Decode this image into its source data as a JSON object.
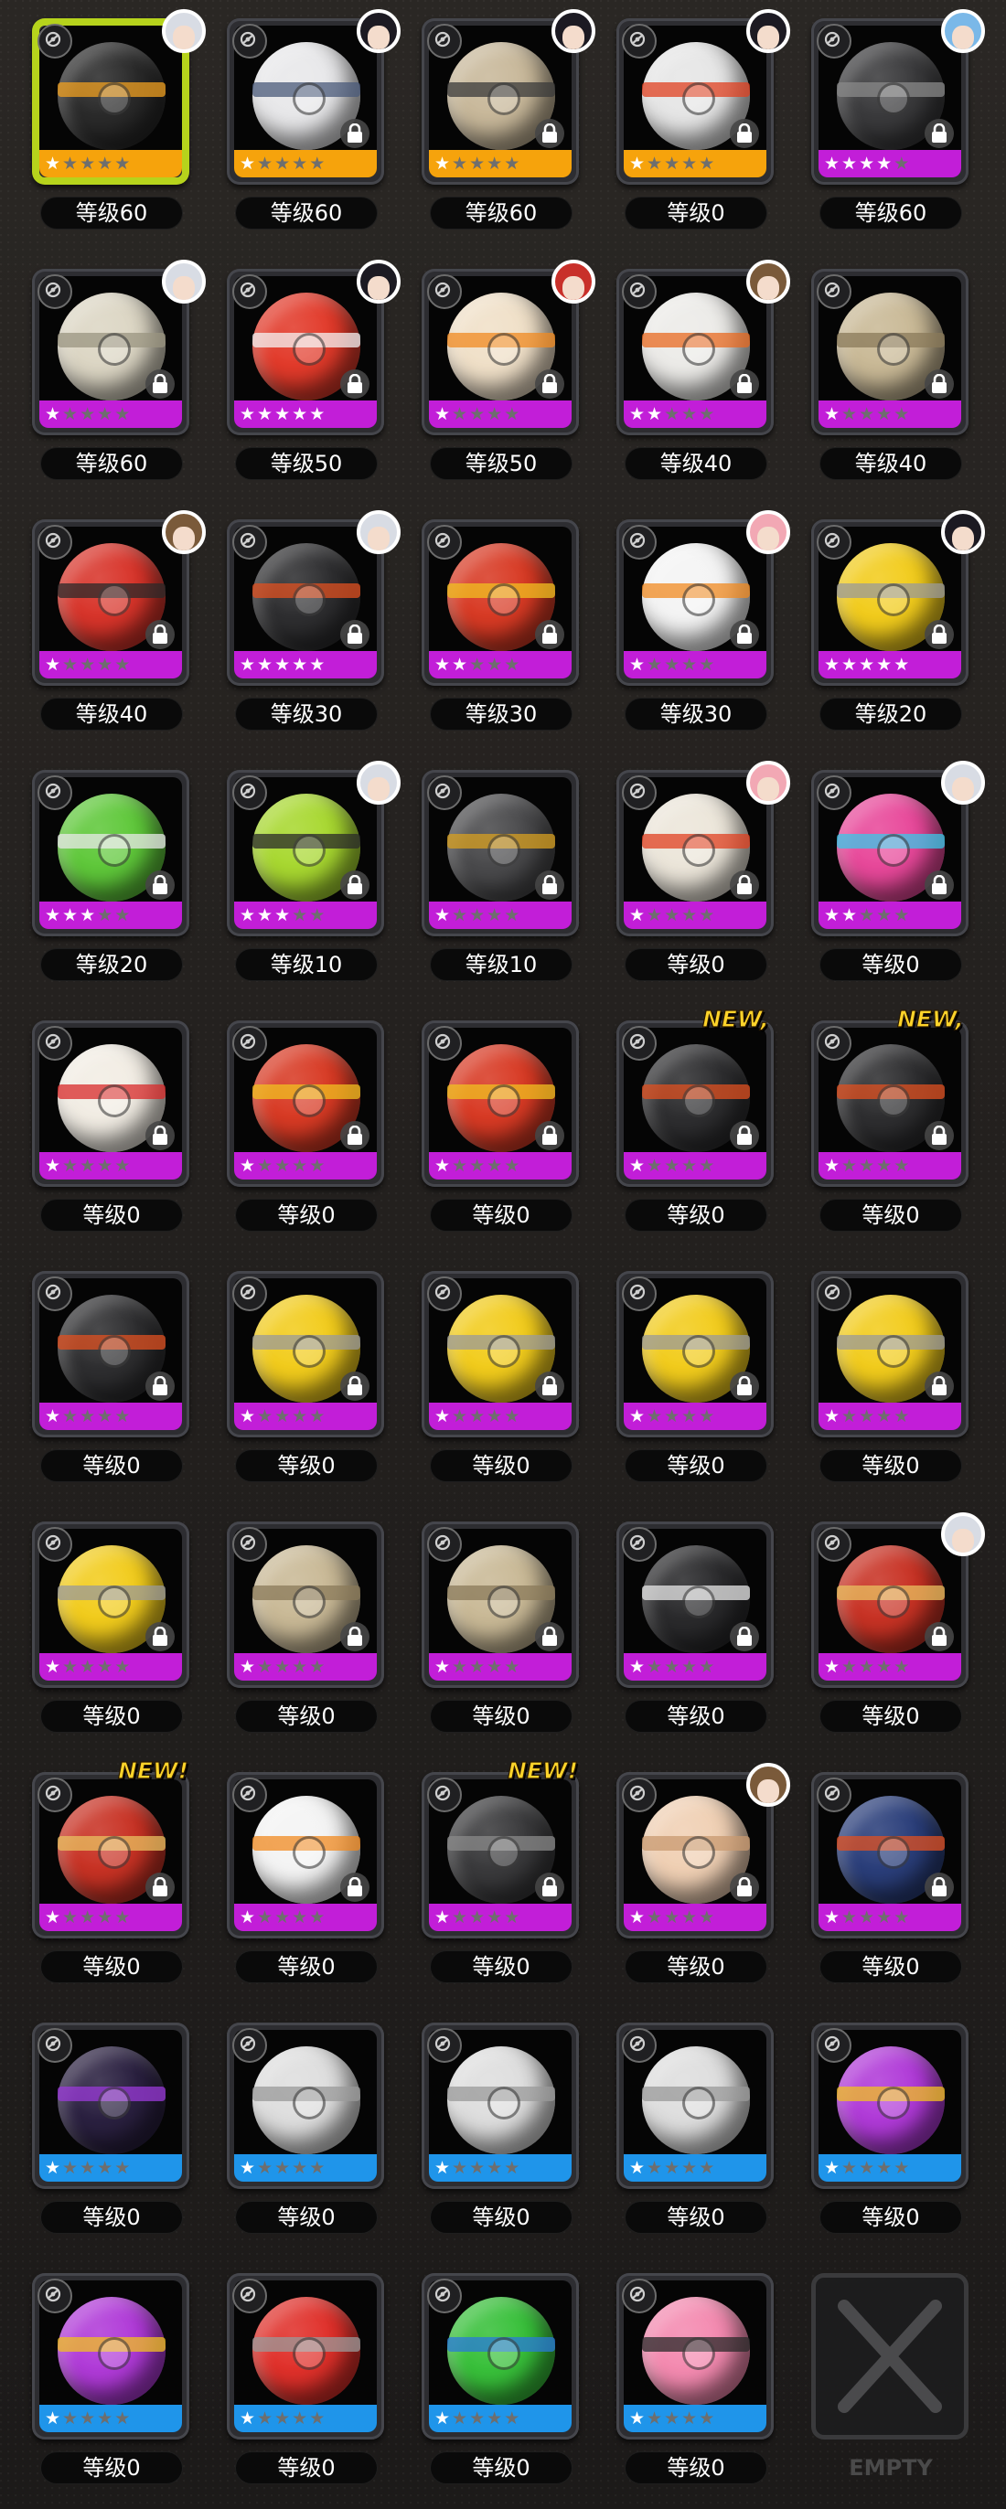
{
  "colors": {
    "selected_border": "#b6d31c",
    "rarity_orange": "#f6a30c",
    "rarity_purple": "#c21ed8",
    "rarity_blue": "#1f95ea",
    "new_badge": "#ffd42a"
  },
  "new_badge_labels": {
    "comma": "NEW,",
    "exclaim": "NEW!"
  },
  "empty_slot": {
    "label": "EMPTY",
    "icon": "x-mark-icon"
  },
  "items": [
    {
      "level": "等级60",
      "rarity": "orange",
      "stars": 1,
      "locked": false,
      "selected": true,
      "portrait": "silver",
      "ball": "#2a2a2a",
      "accent": "#f0a020",
      "new": ""
    },
    {
      "level": "等级60",
      "rarity": "orange",
      "stars": 1,
      "locked": true,
      "portrait": "dark",
      "ball": "#e8e8ea",
      "accent": "#4a5a7a",
      "new": ""
    },
    {
      "level": "等级60",
      "rarity": "orange",
      "stars": 1,
      "locked": true,
      "portrait": "dark",
      "ball": "#c8b89a",
      "accent": "#3a3a3a",
      "new": ""
    },
    {
      "level": "等级0",
      "rarity": "orange",
      "stars": 1,
      "locked": true,
      "portrait": "dark",
      "ball": "#e6e6e6",
      "accent": "#e04020",
      "new": ""
    },
    {
      "level": "等级60",
      "rarity": "purple",
      "stars": 4,
      "locked": true,
      "portrait": "blue",
      "ball": "#3a3a3c",
      "accent": "#8a8a8a",
      "new": ""
    },
    {
      "level": "等级60",
      "rarity": "purple",
      "stars": 1,
      "locked": true,
      "portrait": "silver",
      "ball": "#dcd6c4",
      "accent": "#9a9480",
      "new": ""
    },
    {
      "level": "等级50",
      "rarity": "purple",
      "stars": 5,
      "locked": true,
      "portrait": "dark",
      "ball": "#e23a2a",
      "accent": "#f4f4f4",
      "new": ""
    },
    {
      "level": "等级50",
      "rarity": "purple",
      "stars": 1,
      "locked": true,
      "portrait": "red",
      "ball": "#f0e0c8",
      "accent": "#f08a20",
      "new": ""
    },
    {
      "level": "等级40",
      "rarity": "purple",
      "stars": 2,
      "locked": true,
      "portrait": "brown",
      "ball": "#ecebe8",
      "accent": "#e86a20",
      "new": ""
    },
    {
      "level": "等级40",
      "rarity": "purple",
      "stars": 1,
      "locked": true,
      "portrait": "",
      "ball": "#c9b996",
      "accent": "#8a7a5a",
      "new": ""
    },
    {
      "level": "等级40",
      "rarity": "purple",
      "stars": 1,
      "locked": true,
      "portrait": "brown",
      "ball": "#d8342a",
      "accent": "#2a2a2a",
      "new": ""
    },
    {
      "level": "等级30",
      "rarity": "purple",
      "stars": 5,
      "locked": true,
      "portrait": "silver",
      "ball": "#2e2e30",
      "accent": "#e05020",
      "new": ""
    },
    {
      "level": "等级30",
      "rarity": "purple",
      "stars": 2,
      "locked": true,
      "portrait": "",
      "ball": "#d83a24",
      "accent": "#f0c020",
      "new": ""
    },
    {
      "level": "等级30",
      "rarity": "purple",
      "stars": 1,
      "locked": true,
      "portrait": "pink",
      "ball": "#f4f4f4",
      "accent": "#f08a20",
      "new": ""
    },
    {
      "level": "等级20",
      "rarity": "purple",
      "stars": 5,
      "locked": true,
      "portrait": "dark",
      "ball": "#f2cc1c",
      "accent": "#9a9a9a",
      "new": ""
    },
    {
      "level": "等级20",
      "rarity": "purple",
      "stars": 3,
      "locked": true,
      "portrait": "",
      "ball": "#5fc83a",
      "accent": "#e8e8e8",
      "new": ""
    },
    {
      "level": "等级10",
      "rarity": "purple",
      "stars": 3,
      "locked": true,
      "portrait": "silver",
      "ball": "#a8d830",
      "accent": "#2a2a2a",
      "new": ""
    },
    {
      "level": "等级10",
      "rarity": "purple",
      "stars": 1,
      "locked": true,
      "portrait": "",
      "ball": "#4a4a4c",
      "accent": "#d8a020",
      "new": ""
    },
    {
      "level": "等级0",
      "rarity": "purple",
      "stars": 1,
      "locked": true,
      "portrait": "pink",
      "ball": "#ece6da",
      "accent": "#e04020",
      "new": ""
    },
    {
      "level": "等级0",
      "rarity": "purple",
      "stars": 2,
      "locked": true,
      "portrait": "silver",
      "ball": "#e8489a",
      "accent": "#38c8e8",
      "new": ""
    },
    {
      "level": "等级0",
      "rarity": "purple",
      "stars": 1,
      "locked": true,
      "portrait": "",
      "ball": "#f2ede4",
      "accent": "#d82a2a",
      "new": ""
    },
    {
      "level": "等级0",
      "rarity": "purple",
      "stars": 1,
      "locked": true,
      "portrait": "",
      "ball": "#d83a24",
      "accent": "#f0c020",
      "new": ""
    },
    {
      "level": "等级0",
      "rarity": "purple",
      "stars": 1,
      "locked": true,
      "portrait": "",
      "ball": "#d83a24",
      "accent": "#f0c020",
      "new": ""
    },
    {
      "level": "等级0",
      "rarity": "purple",
      "stars": 1,
      "locked": true,
      "portrait": "",
      "ball": "#2e2e30",
      "accent": "#e05020",
      "new": "comma"
    },
    {
      "level": "等级0",
      "rarity": "purple",
      "stars": 1,
      "locked": true,
      "portrait": "",
      "ball": "#2e2e30",
      "accent": "#e05020",
      "new": "comma"
    },
    {
      "level": "等级0",
      "rarity": "purple",
      "stars": 1,
      "locked": true,
      "portrait": "",
      "ball": "#2e2e30",
      "accent": "#e05020",
      "new": ""
    },
    {
      "level": "等级0",
      "rarity": "purple",
      "stars": 1,
      "locked": true,
      "portrait": "",
      "ball": "#f2cc1c",
      "accent": "#9a9a9a",
      "new": ""
    },
    {
      "level": "等级0",
      "rarity": "purple",
      "stars": 1,
      "locked": true,
      "portrait": "",
      "ball": "#f2cc1c",
      "accent": "#9a9a9a",
      "new": ""
    },
    {
      "level": "等级0",
      "rarity": "purple",
      "stars": 1,
      "locked": true,
      "portrait": "",
      "ball": "#f2cc1c",
      "accent": "#9a9a9a",
      "new": ""
    },
    {
      "level": "等级0",
      "rarity": "purple",
      "stars": 1,
      "locked": true,
      "portrait": "",
      "ball": "#f2cc1c",
      "accent": "#9a9a9a",
      "new": ""
    },
    {
      "level": "等级0",
      "rarity": "purple",
      "stars": 1,
      "locked": true,
      "portrait": "",
      "ball": "#f2cc1c",
      "accent": "#9a9a9a",
      "new": ""
    },
    {
      "level": "等级0",
      "rarity": "purple",
      "stars": 1,
      "locked": true,
      "portrait": "",
      "ball": "#c9b996",
      "accent": "#8a7a5a",
      "new": ""
    },
    {
      "level": "等级0",
      "rarity": "purple",
      "stars": 1,
      "locked": true,
      "portrait": "",
      "ball": "#c9b996",
      "accent": "#8a7a5a",
      "new": ""
    },
    {
      "level": "等级0",
      "rarity": "purple",
      "stars": 1,
      "locked": true,
      "portrait": "",
      "ball": "#2a2a2c",
      "accent": "#e8e8e8",
      "new": ""
    },
    {
      "level": "等级0",
      "rarity": "purple",
      "stars": 1,
      "locked": true,
      "portrait": "silver",
      "ball": "#c83224",
      "accent": "#e8c060",
      "new": ""
    },
    {
      "level": "等级0",
      "rarity": "purple",
      "stars": 1,
      "locked": true,
      "portrait": "",
      "ball": "#c83224",
      "accent": "#e8c060",
      "new": "exclaim"
    },
    {
      "level": "等级0",
      "rarity": "purple",
      "stars": 1,
      "locked": true,
      "portrait": "",
      "ball": "#f4f4f4",
      "accent": "#f08a20",
      "new": ""
    },
    {
      "level": "等级0",
      "rarity": "purple",
      "stars": 1,
      "locked": true,
      "portrait": "",
      "ball": "#3a3a3c",
      "accent": "#8a8a8a",
      "new": "exclaim"
    },
    {
      "level": "等级0",
      "rarity": "purple",
      "stars": 1,
      "locked": true,
      "portrait": "brown",
      "ball": "#f0d0b4",
      "accent": "#c89a70",
      "new": ""
    },
    {
      "level": "等级0",
      "rarity": "purple",
      "stars": 1,
      "locked": true,
      "portrait": "",
      "ball": "#2a3e7a",
      "accent": "#e05020",
      "new": ""
    },
    {
      "level": "等级0",
      "rarity": "blue",
      "stars": 1,
      "locked": false,
      "portrait": "",
      "ball": "#2a2040",
      "accent": "#9a3ad8",
      "new": ""
    },
    {
      "level": "等级0",
      "rarity": "blue",
      "stars": 1,
      "locked": false,
      "portrait": "",
      "ball": "#dedede",
      "accent": "#9a9a9a",
      "new": ""
    },
    {
      "level": "等级0",
      "rarity": "blue",
      "stars": 1,
      "locked": false,
      "portrait": "",
      "ball": "#dedede",
      "accent": "#9a9a9a",
      "new": ""
    },
    {
      "level": "等级0",
      "rarity": "blue",
      "stars": 1,
      "locked": false,
      "portrait": "",
      "ball": "#dedede",
      "accent": "#9a9a9a",
      "new": ""
    },
    {
      "level": "等级0",
      "rarity": "blue",
      "stars": 1,
      "locked": false,
      "portrait": "",
      "ball": "#b03ad8",
      "accent": "#f0c020",
      "new": ""
    },
    {
      "level": "等级0",
      "rarity": "blue",
      "stars": 1,
      "locked": false,
      "portrait": "",
      "ball": "#b03ad8",
      "accent": "#f0c020",
      "new": ""
    },
    {
      "level": "等级0",
      "rarity": "blue",
      "stars": 1,
      "locked": false,
      "portrait": "",
      "ball": "#e0302a",
      "accent": "#9a9a9a",
      "new": ""
    },
    {
      "level": "等级0",
      "rarity": "blue",
      "stars": 1,
      "locked": false,
      "portrait": "",
      "ball": "#38c03a",
      "accent": "#2a7ad8",
      "new": ""
    },
    {
      "level": "等级0",
      "rarity": "blue",
      "stars": 1,
      "locked": false,
      "portrait": "",
      "ball": "#f48ab0",
      "accent": "#2a2a2a",
      "new": ""
    },
    {
      "level": "",
      "rarity": "empty",
      "stars": 0,
      "locked": false,
      "portrait": "",
      "ball": "",
      "accent": "",
      "new": ""
    }
  ]
}
